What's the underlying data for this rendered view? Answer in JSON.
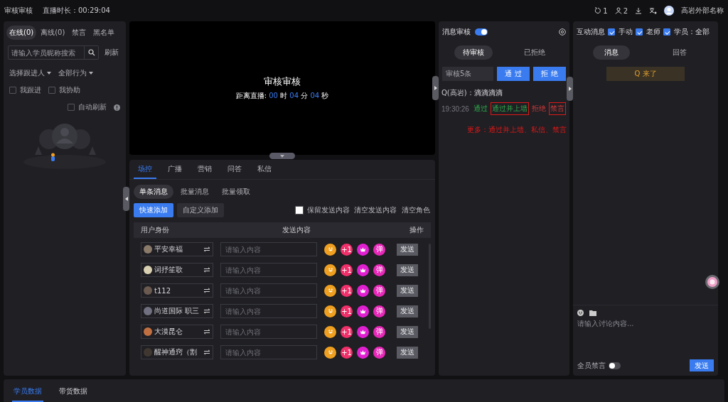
{
  "header": {
    "title": "审核审核",
    "duration_label": "直播时长：",
    "duration": "00:29:04",
    "counters": [
      {
        "kind": "likes",
        "value": "1"
      },
      {
        "kind": "users",
        "value": "2"
      }
    ],
    "user_name": "高岩外部名称"
  },
  "left_panel": {
    "tabs": [
      {
        "label": "在线(0)",
        "selected": true
      },
      {
        "label": "离线(0)",
        "selected": false
      },
      {
        "label": "禁言",
        "selected": false
      },
      {
        "label": "黑名单",
        "selected": false
      }
    ],
    "search": {
      "placeholder": "请输入学员昵称搜索"
    },
    "refresh": "刷新",
    "filters": [
      "选择跟进人",
      "全部行为"
    ],
    "checks": [
      {
        "label": "我跟进",
        "checked": false
      },
      {
        "label": "我协助",
        "checked": false
      }
    ],
    "auto_refresh": {
      "label": "自动刷新",
      "checked": false
    }
  },
  "video": {
    "title": "审核审核",
    "countdown_label": "距离直播:",
    "countdown": [
      {
        "value": "00",
        "unit": "时"
      },
      {
        "value": "04",
        "unit": "分"
      },
      {
        "value": "04",
        "unit": "秒"
      }
    ]
  },
  "control": {
    "tabs": [
      {
        "label": "场控",
        "selected": true
      },
      {
        "label": "广播",
        "selected": false
      },
      {
        "label": "营销",
        "selected": false
      },
      {
        "label": "问答",
        "selected": false
      },
      {
        "label": "私信",
        "selected": false
      }
    ],
    "subtabs": [
      {
        "label": "单条消息",
        "selected": true
      },
      {
        "label": "批量消息",
        "selected": false
      },
      {
        "label": "批量领取",
        "selected": false
      }
    ],
    "buttons": [
      {
        "label": "快速添加",
        "kind": "primary"
      },
      {
        "label": "自定义添加",
        "kind": "secondary"
      }
    ],
    "keep": {
      "label": "保留发送内容",
      "checked": false
    },
    "clear_links": [
      "清空发送内容",
      "清空角色"
    ],
    "columns": [
      "用户身份",
      "发送内容",
      "操作"
    ],
    "rows": [
      {
        "name": "平安幸福",
        "color": "#8a7a6a",
        "placeholder": "请输入内容",
        "actions": [
          {
            "kind": "emoji"
          },
          {
            "kind": "text",
            "label": "+1"
          },
          {
            "kind": "gift"
          },
          {
            "kind": "text",
            "label": "弹"
          }
        ],
        "send": "发送"
      },
      {
        "name": "词抒笙歌",
        "color": "#d8d0b0",
        "placeholder": "请输入内容",
        "actions": [
          {
            "kind": "emoji"
          },
          {
            "kind": "text",
            "label": "+1"
          },
          {
            "kind": "gift"
          },
          {
            "kind": "text",
            "label": "弹"
          }
        ],
        "send": "发送"
      },
      {
        "name": "t112",
        "color": "#6a5a50",
        "placeholder": "请输入内容",
        "actions": [
          {
            "kind": "emoji"
          },
          {
            "kind": "text",
            "label": "+1"
          },
          {
            "kind": "gift"
          },
          {
            "kind": "text",
            "label": "弹"
          }
        ],
        "send": "发送"
      },
      {
        "name": "尚道国际 职三",
        "color": "#707080",
        "placeholder": "请输入内容",
        "actions": [
          {
            "kind": "emoji"
          },
          {
            "kind": "text",
            "label": "+1"
          },
          {
            "kind": "gift"
          },
          {
            "kind": "text",
            "label": "弹"
          }
        ],
        "send": "发送"
      },
      {
        "name": "大漠昆仑",
        "color": "#c07040",
        "placeholder": "请输入内容",
        "actions": [
          {
            "kind": "emoji"
          },
          {
            "kind": "text",
            "label": "+1"
          },
          {
            "kind": "gift"
          },
          {
            "kind": "text",
            "label": "弹"
          }
        ],
        "send": "发送"
      },
      {
        "name": "醒神通窍（割",
        "color": "#403830",
        "placeholder": "请输入内容",
        "actions": [
          {
            "kind": "emoji"
          },
          {
            "kind": "text",
            "label": "+1"
          },
          {
            "kind": "gift"
          },
          {
            "kind": "text",
            "label": "弹"
          }
        ],
        "send": "发送"
      }
    ]
  },
  "audit": {
    "title": "消息审核",
    "enabled": true,
    "tabs": [
      {
        "label": "待审核",
        "selected": true
      },
      {
        "label": "已拒绝",
        "selected": false
      }
    ],
    "batch": "审核5条",
    "buttons": [
      "通 过",
      "拒 绝"
    ],
    "messages": [
      {
        "author": "Q(高岩)：",
        "text": "滴滴滴滴",
        "time": "19:30:26",
        "actions": [
          {
            "label": "通过",
            "kind": "approve",
            "highlighted": false
          },
          {
            "label": "通过并上墙",
            "kind": "approve",
            "highlighted": true
          },
          {
            "label": "拒绝",
            "kind": "reject",
            "highlighted": false
          },
          {
            "label": "禁言",
            "kind": "reject",
            "highlighted": true
          }
        ]
      }
    ],
    "note": "更多：通过并上墙、私信、禁言"
  },
  "interactive": {
    "title": "互动消息",
    "filters": [
      {
        "label": "手动",
        "checked": true
      },
      {
        "label": "老师",
        "checked": true
      },
      {
        "label": "学员：全部",
        "checked": true
      }
    ],
    "tabs": [
      {
        "label": "消息",
        "selected": true
      },
      {
        "label": "回答",
        "selected": false
      }
    ],
    "messages": [
      "Q 来了"
    ],
    "composer": {
      "placeholder": "请输入讨论内容..."
    },
    "mute_all": {
      "label": "全员禁言",
      "on": false
    },
    "send": "发送"
  },
  "bottom_tabs": [
    {
      "label": "学员数据",
      "selected": true
    },
    {
      "label": "带货数据",
      "selected": false
    }
  ]
}
